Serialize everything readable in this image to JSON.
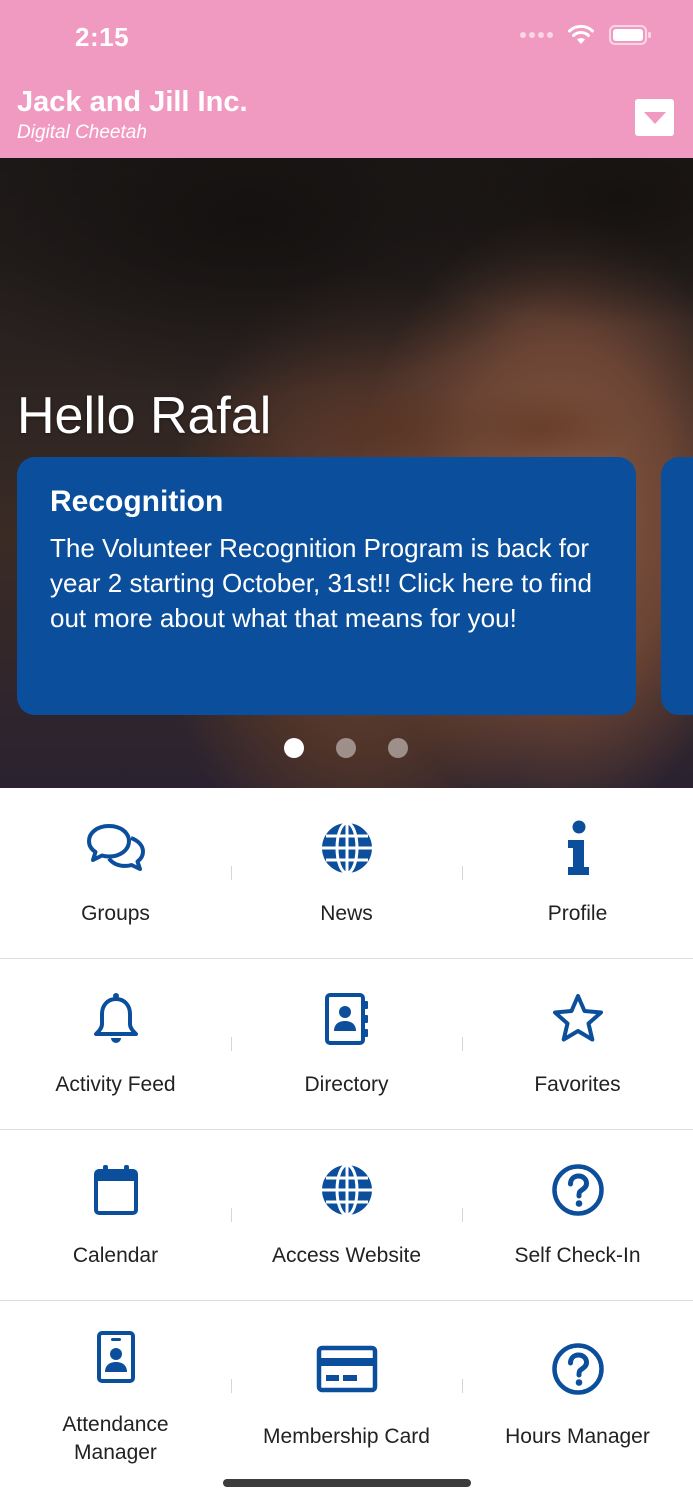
{
  "status_bar": {
    "time": "2:15"
  },
  "header": {
    "title": "Jack and Jill Inc.",
    "subtitle": "Digital Cheetah"
  },
  "hero": {
    "greeting": "Hello Rafal",
    "card": {
      "title": "Recognition",
      "body": "The Volunteer Recognition Program is back for year 2 starting October, 31st!! Click here to find out more about what that means for you!"
    },
    "pager": {
      "count": 3,
      "active": 1
    }
  },
  "grid": [
    [
      {
        "label": "Groups",
        "icon": "chat-bubbles-icon"
      },
      {
        "label": "News",
        "icon": "globe-icon"
      },
      {
        "label": "Profile",
        "icon": "info-icon"
      }
    ],
    [
      {
        "label": "Activity Feed",
        "icon": "bell-icon"
      },
      {
        "label": "Directory",
        "icon": "contact-book-icon"
      },
      {
        "label": "Favorites",
        "icon": "star-icon"
      }
    ],
    [
      {
        "label": "Calendar",
        "icon": "calendar-icon"
      },
      {
        "label": "Access Website",
        "icon": "globe-icon"
      },
      {
        "label": "Self Check-In",
        "icon": "question-circle-icon"
      }
    ],
    [
      {
        "label": "Attendance Manager",
        "icon": "id-badge-icon"
      },
      {
        "label": "Membership Card",
        "icon": "credit-card-icon"
      },
      {
        "label": "Hours Manager",
        "icon": "question-circle-icon"
      }
    ]
  ],
  "colors": {
    "header_bg": "#f19ac1",
    "accent": "#0b4f9c"
  }
}
